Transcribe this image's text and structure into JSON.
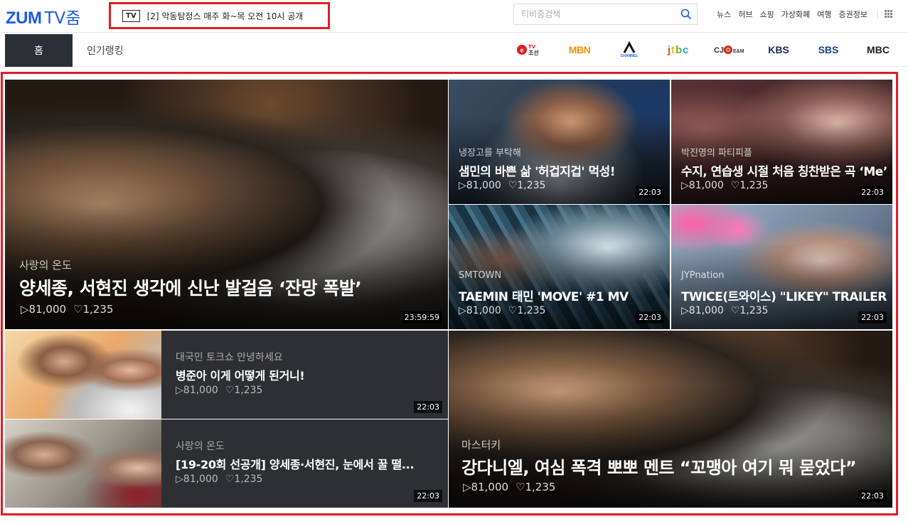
{
  "header": {
    "logo_zum": "ZUM",
    "logo_tv": "TV줌",
    "notice_badge": "TV",
    "notice_text": "[2] 악동탐정스 매주 화~목 오전 10시 공개",
    "search_placeholder": "티비줌검색",
    "gnb": [
      "뉴스",
      "허브",
      "쇼핑",
      "가상화폐",
      "여행",
      "증권정보"
    ]
  },
  "subnav": {
    "home": "홈",
    "ranking": "인기랭킹",
    "channels": [
      {
        "label": "TV조선",
        "color": "#e31c23"
      },
      {
        "label": "MBN",
        "color": "#f39200"
      },
      {
        "label": "CHANNEL A",
        "color": "#111111"
      },
      {
        "label": "jtbc",
        "color": "#e8521b"
      },
      {
        "label": "CJ E&M",
        "color": "#333333"
      },
      {
        "label": "KBS",
        "color": "#1b2a55"
      },
      {
        "label": "SBS",
        "color": "#1b3c8f"
      },
      {
        "label": "MBC",
        "color": "#222222"
      }
    ]
  },
  "videos": {
    "main": {
      "category": "사랑의 온도",
      "title": "양세종, 서현진 생각에 신난 발걸음 ‘잔망 폭발’",
      "plays": "81,000",
      "likes": "1,235",
      "duration": "23:59:59"
    },
    "t1": {
      "category": "냉장고를 부탁해",
      "title": "샘민의 바쁜 삶 '허겁지겁' 먹성!",
      "plays": "81,000",
      "likes": "1,235",
      "duration": "22:03"
    },
    "t2": {
      "category": "박진영의 파티피플",
      "title": "수지, 연습생 시절 처음 칭찬받은 곡 ‘Me’",
      "plays": "81,000",
      "likes": "1,235",
      "duration": "22:03"
    },
    "t3": {
      "category": "SMTOWN",
      "title": "TAEMIN 태민 'MOVE' #1 MV",
      "plays": "81,000",
      "likes": "1,235",
      "duration": "22:03"
    },
    "t4": {
      "category": "JYPnation",
      "title": "TWICE(트와이스) \"LIKEY\" TRAILER",
      "plays": "81,000",
      "likes": "1,235",
      "duration": "22:03"
    },
    "r1": {
      "category": "대국민 토크쇼 안녕하세요",
      "title": "병준아 이게 어떻게 된거니!",
      "plays": "81,000",
      "likes": "1,235",
      "duration": "22:03"
    },
    "r2": {
      "category": "사랑의 온도",
      "title": "[19-20회 선공개] 양세종·서현진, 눈에서 꿀 떨...",
      "plays": "81,000",
      "likes": "1,235",
      "duration": "22:03"
    },
    "big2": {
      "category": "마스터키",
      "title": "강다니엘, 여심 폭격 뽀뽀 멘트 “꼬맹아 여기 뭐 묻었다”",
      "plays": "81,000",
      "likes": "1,235",
      "duration": "22:03"
    }
  },
  "icons": {
    "play": "play-icon",
    "like": "heart-icon",
    "search": "search-icon",
    "apps": "grid-icon"
  }
}
